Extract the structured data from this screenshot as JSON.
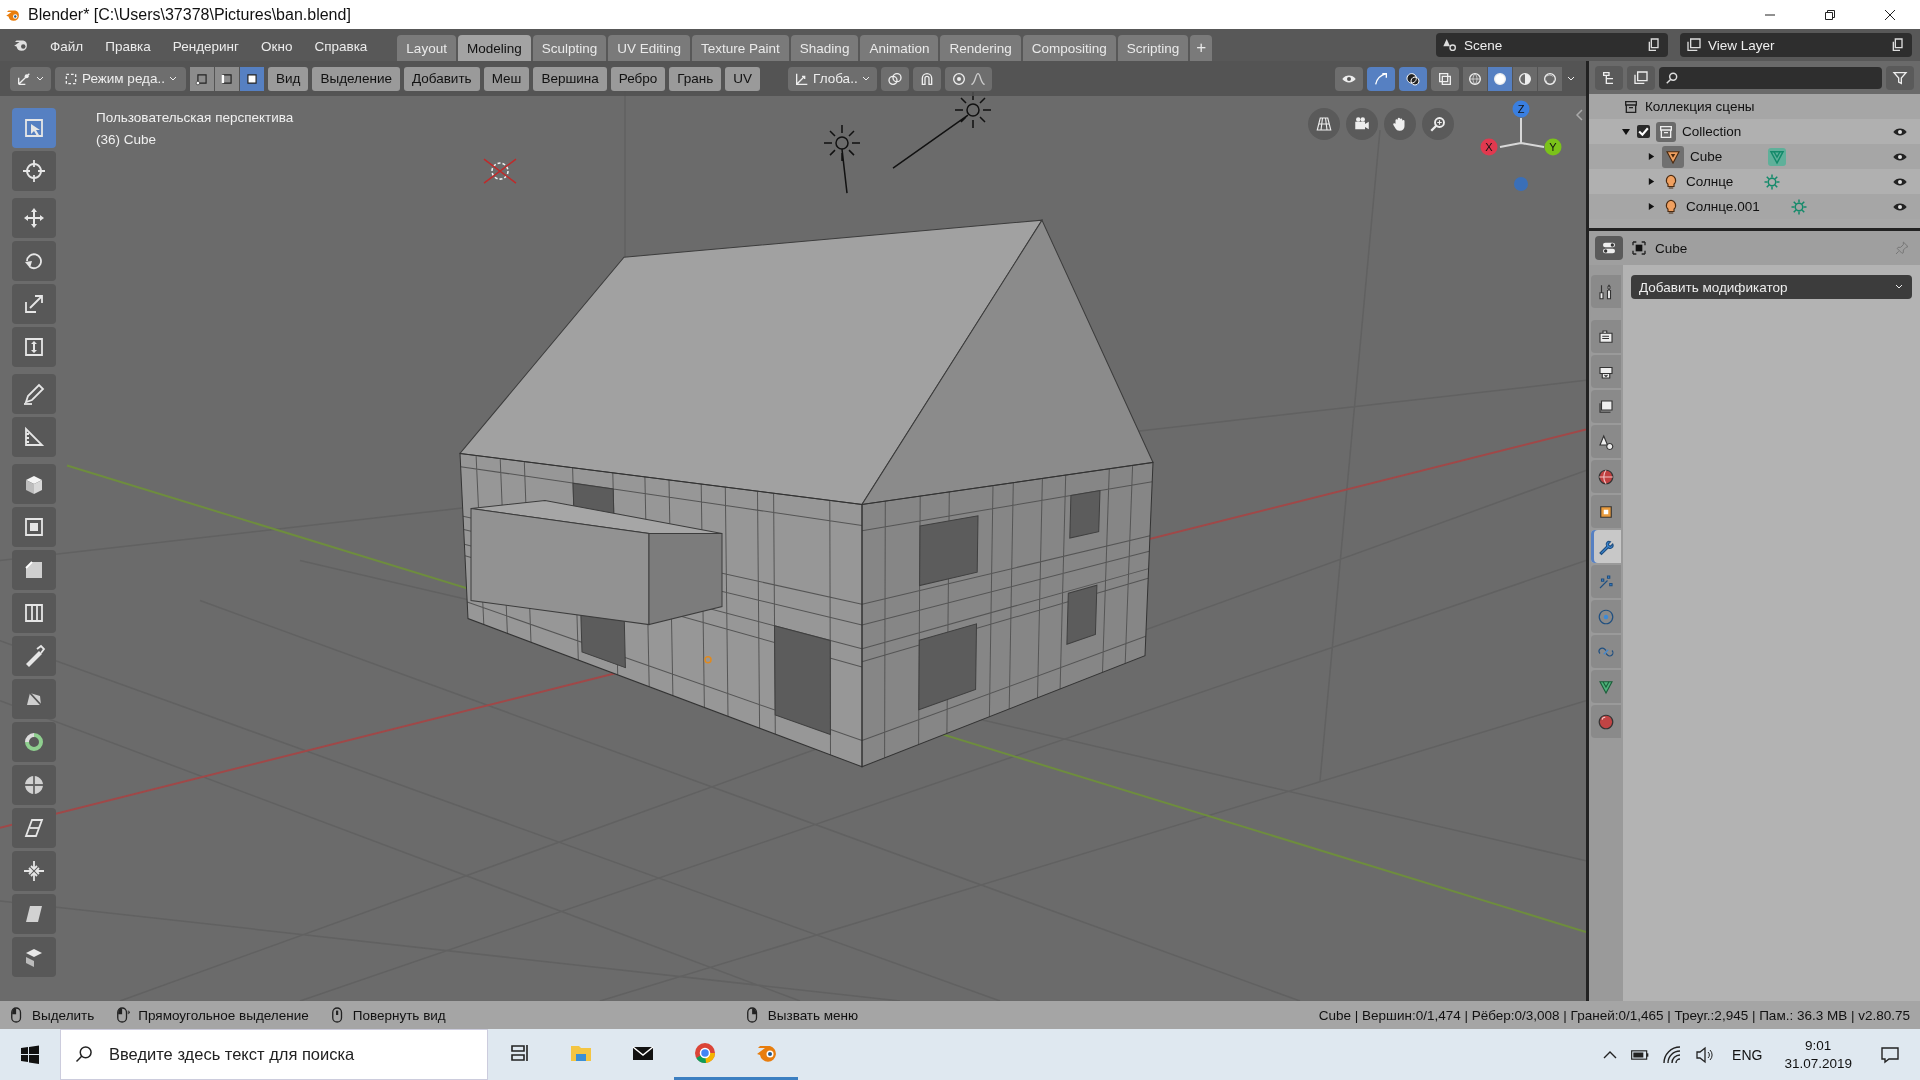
{
  "window": {
    "title": "Blender* [C:\\Users\\37378\\Pictures\\ban.blend]"
  },
  "menu": [
    "Файл",
    "Правка",
    "Рендеринг",
    "Окно",
    "Справка"
  ],
  "workspaces": [
    {
      "label": "Layout",
      "selected": false
    },
    {
      "label": "Modeling",
      "selected": true
    },
    {
      "label": "Sculpting",
      "selected": false
    },
    {
      "label": "UV Editing",
      "selected": false
    },
    {
      "label": "Texture Paint",
      "selected": false
    },
    {
      "label": "Shading",
      "selected": false
    },
    {
      "label": "Animation",
      "selected": false
    },
    {
      "label": "Rendering",
      "selected": false
    },
    {
      "label": "Compositing",
      "selected": false
    },
    {
      "label": "Scripting",
      "selected": false
    }
  ],
  "add_workspace": "+",
  "scene": "Scene",
  "view_layer": "View Layer",
  "viewport": {
    "header": {
      "mode": "Режим реда..",
      "select_modes": [
        {
          "kind": "vertex",
          "selected": false
        },
        {
          "kind": "edge",
          "selected": false
        },
        {
          "kind": "face",
          "selected": true
        }
      ],
      "menus": [
        "Вид",
        "Выделение",
        "Добавить",
        "Меш",
        "Вершина",
        "Ребро",
        "Грань",
        "UV"
      ],
      "orientation": "Глоба..",
      "toggles": [
        {
          "kind": "gizmo",
          "on": true
        },
        {
          "kind": "overlay",
          "on": true
        },
        {
          "kind": "xray",
          "on": false
        }
      ],
      "shading": [
        {
          "kind": "wireframe",
          "selected": false
        },
        {
          "kind": "solid",
          "selected": true
        },
        {
          "kind": "material",
          "selected": false
        },
        {
          "kind": "rendered",
          "selected": false
        }
      ]
    },
    "view_name": "Пользовательская перспектива",
    "object_info": "(36) Cube",
    "axes": [
      "X",
      "Y",
      "Z"
    ],
    "tools": [
      [
        {
          "kind": "select",
          "selected": true
        },
        {
          "kind": "cursor",
          "selected": false
        }
      ],
      [
        {
          "kind": "move",
          "selected": false
        },
        {
          "kind": "rotate",
          "selected": false
        },
        {
          "kind": "scale",
          "selected": false
        },
        {
          "kind": "transform",
          "selected": false
        }
      ],
      [
        {
          "kind": "annotate",
          "selected": false
        },
        {
          "kind": "measure",
          "selected": false
        }
      ],
      [
        {
          "kind": "extrude",
          "selected": false
        },
        {
          "kind": "inset",
          "selected": false
        },
        {
          "kind": "bevel",
          "selected": false
        },
        {
          "kind": "loopcut",
          "selected": false
        },
        {
          "kind": "knife",
          "selected": false
        },
        {
          "kind": "polybuild",
          "selected": false
        },
        {
          "kind": "spin",
          "selected": false
        },
        {
          "kind": "smooth",
          "selected": false
        },
        {
          "kind": "edgeslide",
          "selected": false
        },
        {
          "kind": "shrink",
          "selected": false
        },
        {
          "kind": "shear",
          "selected": false
        },
        {
          "kind": "rip",
          "selected": false
        }
      ]
    ]
  },
  "outliner": {
    "root": "Коллекция сцены",
    "items": [
      {
        "label": "Collection",
        "kind": "collection",
        "expanded": true,
        "checked": true,
        "children": [
          {
            "label": "Cube",
            "kind": "mesh",
            "active": true,
            "expanded": false
          },
          {
            "label": "Солнце",
            "kind": "light",
            "active": false,
            "expanded": false
          },
          {
            "label": "Солнце.001",
            "kind": "light",
            "active": false,
            "expanded": false
          }
        ]
      }
    ]
  },
  "properties": {
    "object": "Cube",
    "add_modifier": "Добавить модификатор",
    "tabs": [
      {
        "kind": "tool",
        "selected": false
      },
      {
        "kind": "render",
        "selected": false
      },
      {
        "kind": "output",
        "selected": false
      },
      {
        "kind": "viewlayer",
        "selected": false
      },
      {
        "kind": "scene",
        "selected": false
      },
      {
        "kind": "world",
        "selected": false
      },
      {
        "kind": "object",
        "selected": false
      },
      {
        "kind": "modifier",
        "selected": true
      },
      {
        "kind": "particles",
        "selected": false
      },
      {
        "kind": "physics",
        "selected": false
      },
      {
        "kind": "constraints",
        "selected": false
      },
      {
        "kind": "data",
        "selected": false
      },
      {
        "kind": "material",
        "selected": false
      }
    ]
  },
  "status_bar": {
    "hints": [
      {
        "kind": "left",
        "label": "Выделить"
      },
      {
        "kind": "drag",
        "label": "Прямоугольное выделение"
      },
      {
        "kind": "middle",
        "label": "Повернуть вид"
      },
      {
        "kind": "right",
        "label": "Вызвать меню"
      }
    ],
    "stats": "Cube | Вершин:0/1,474 | Рёбер:0/3,008 | Граней:0/1,465 | Треуг.:2,945 | Пам.: 36.3 MB | v2.80.75"
  },
  "taskbar": {
    "search_placeholder": "Введите здесь текст для поиска",
    "apps": [
      {
        "kind": "taskview",
        "open": false
      },
      {
        "kind": "explorer",
        "open": false
      },
      {
        "kind": "mail",
        "open": false
      },
      {
        "kind": "chrome",
        "open": true
      },
      {
        "kind": "blender",
        "open": true
      }
    ],
    "language": "ENG",
    "time": "9:01",
    "date": "31.07.2019"
  }
}
